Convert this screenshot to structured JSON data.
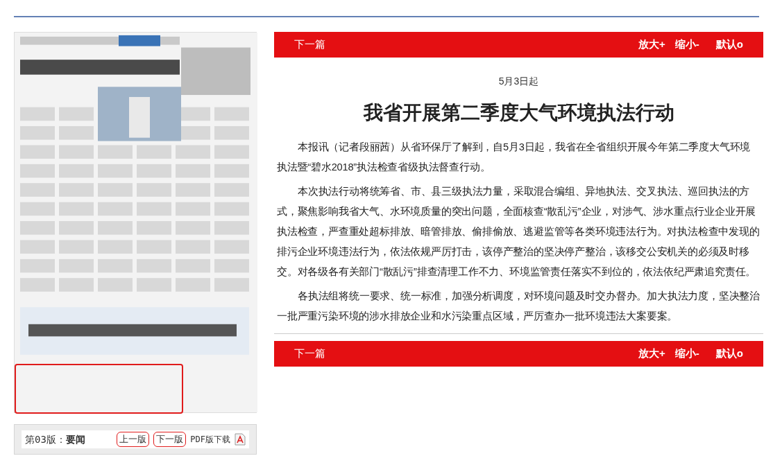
{
  "newspaper_page": {
    "kind": "picture",
    "highlighted": true
  },
  "page_nav": {
    "edition": "第03版：",
    "section": "要闻",
    "prev": "上一版",
    "next": "下一版",
    "pdf": "PDF版下载"
  },
  "top_toolbar": {
    "next": "下一篇",
    "zoom_in": "放大+",
    "zoom_out": "缩小-",
    "reset": "默认o"
  },
  "article": {
    "subtitle": "5月3日起",
    "title": "我省开展第二季度大气环境执法行动",
    "paragraphs": [
      "本报讯（记者段丽茜）从省环保厅了解到，自5月3日起，我省在全省组织开展今年第二季度大气环境执法暨“碧水2018”执法检查省级执法督查行动。",
      "本次执法行动将统筹省、市、县三级执法力量，采取混合编组、异地执法、交叉执法、巡回执法的方式，聚焦影响我省大气、水环境质量的突出问题，全面核查“散乱污”企业，对涉气、涉水重点行业企业开展执法检查，严查重处超标排放、暗管排放、偷排偷放、逃避监管等各类环境违法行为。对执法检查中发现的排污企业环境违法行为，依法依规严厉打击，该停产整治的坚决停产整治，该移交公安机关的必须及时移交。对各级各有关部门“散乱污”排查清理工作不力、环境监管责任落实不到位的，依法依纪严肃追究责任。",
      "各执法组将统一要求、统一标准，加强分析调度，对环境问题及时交办督办。加大执法力度，坚决整治一批严重污染环境的涉水排放企业和水污染重点区域，严厉查办一批环境违法大案要案。"
    ]
  },
  "bottom_toolbar": {
    "next": "下一篇",
    "zoom_in": "放大+",
    "zoom_out": "缩小-",
    "reset": "默认o"
  }
}
